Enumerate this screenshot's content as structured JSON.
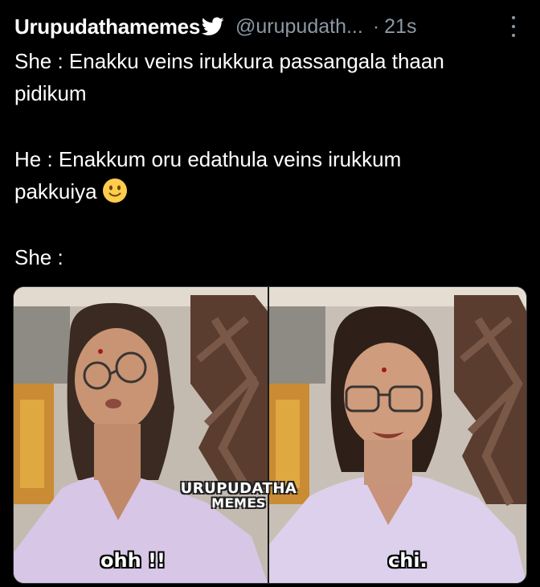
{
  "tweet": {
    "author_name": "Urupudathamemes",
    "handle": "@urupudath...",
    "separator": "·",
    "time": "21s",
    "bird_icon": "twitter-bird-icon",
    "more_icon": "more-vertical-icon",
    "lines": {
      "l1": "She : Enakku veins irukkura passangala thaan",
      "l2": "pidikum",
      "l3": "He : Enakkum oru edathula veins irukkum",
      "l4": "pakkuiya",
      "l5": "She :"
    },
    "emoji": "slightly-smiling-face-icon"
  },
  "media": {
    "left_caption": "ohh !!",
    "right_caption": "chi.",
    "watermark_line1": "URUPUDATHA",
    "watermark_line2": "MEMES"
  },
  "colors": {
    "background": "#000000",
    "text": "#ffffff",
    "muted": "#8b98a5",
    "accent": "#ffffff"
  }
}
